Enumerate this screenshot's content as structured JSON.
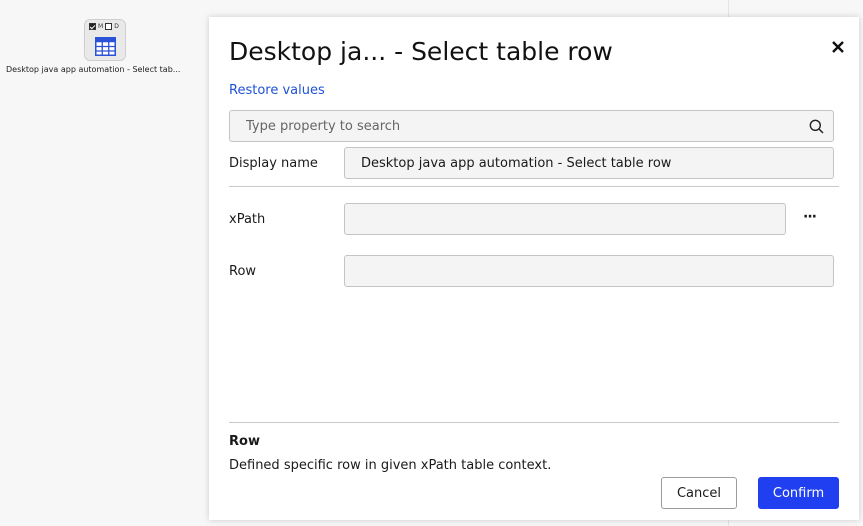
{
  "canvas": {
    "node": {
      "check_labels": [
        "M",
        "D"
      ],
      "label": "Desktop java app automation - Select tab..."
    }
  },
  "dialog": {
    "title": "Desktop ja... - Select table row",
    "restore_label": "Restore values",
    "search": {
      "placeholder": "Type property to search"
    },
    "fields": {
      "display_name": {
        "label": "Display name",
        "value": "Desktop java app automation - Select table row"
      },
      "xpath": {
        "label": "xPath",
        "value": "",
        "more": "···"
      },
      "row": {
        "label": "Row",
        "value": ""
      }
    },
    "description": {
      "title": "Row",
      "text": "Defined specific row in given xPath table context."
    },
    "buttons": {
      "cancel": "Cancel",
      "confirm": "Confirm"
    }
  },
  "colors": {
    "accent": "#1f3ff0",
    "link": "#1f52d9"
  },
  "icons": [
    "checkbox-icon",
    "table-icon",
    "close-icon",
    "search-icon",
    "more-icon"
  ]
}
